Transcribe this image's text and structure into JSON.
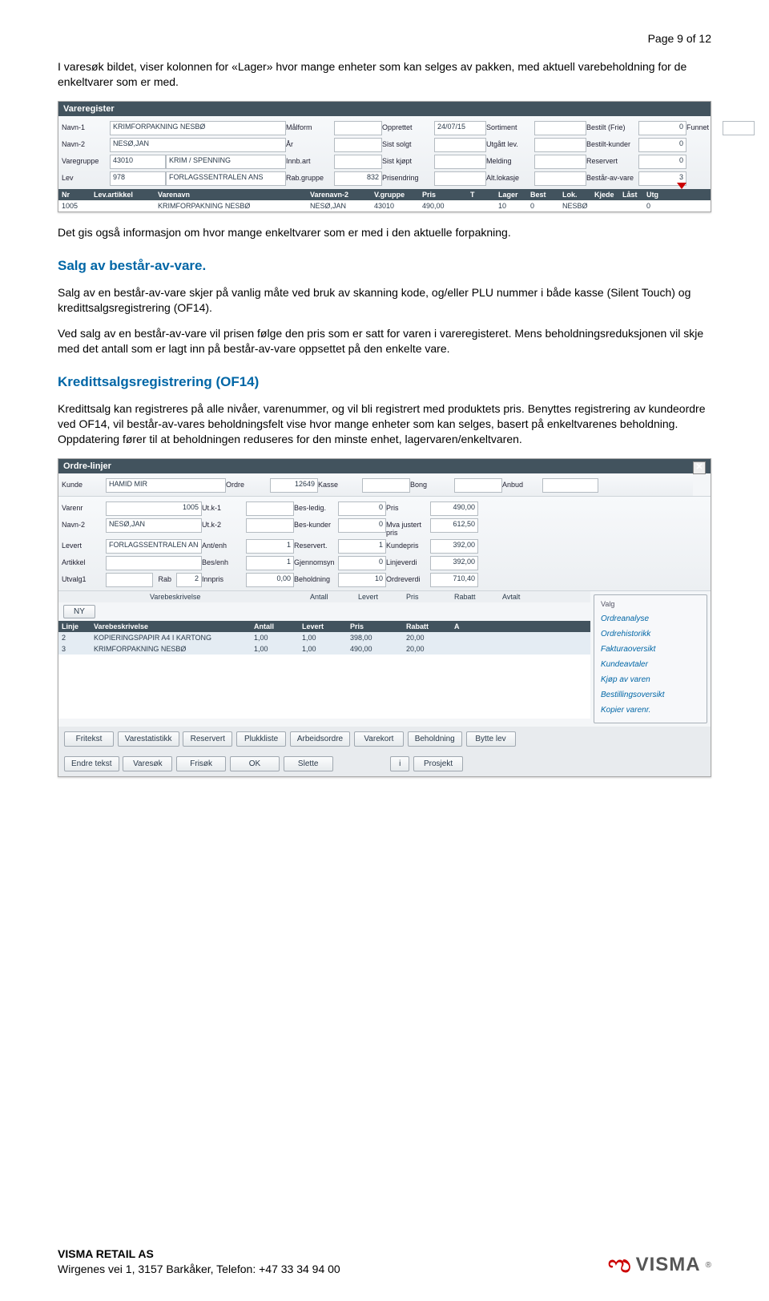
{
  "page_header": "Page 9 of 12",
  "intro_p": "I varesøk bildet, viser kolonnen for «Lager» hvor mange enheter som kan selges av pakken, med aktuell varebeholdning for de enkeltvarer som er med.",
  "s1": {
    "title": "Vareregister",
    "labels": {
      "navn1": "Navn-1",
      "navn2": "Navn-2",
      "varegruppe": "Varegruppe",
      "lev": "Lev",
      "malform": "Målform",
      "ar": "År",
      "innbart": "Innb.art",
      "rabgruppe": "Rab.gruppe",
      "opprettet": "Opprettet",
      "sistsolgt": "Sist solgt",
      "sistkjopt": "Sist kjøpt",
      "prisendring": "Prisendring",
      "sortiment": "Sortiment",
      "utgatt": "Utgått lev.",
      "melding": "Melding",
      "altlok": "Alt.lokasje",
      "bestiltfrie": "Bestilt (Frie)",
      "bestiltkunder": "Bestilt-kunder",
      "reservert": "Reservert",
      "bestaravvare": "Består-av-vare",
      "funnet": "Funnet"
    },
    "vals": {
      "navn1": "KRIMFORPAKNING NESBØ",
      "navn2": "NESØ,JAN",
      "vg_code": "43010",
      "vg_name": "KRIM / SPENNING",
      "lev_code": "978",
      "lev_name": "FORLAGSSENTRALEN ANS",
      "rabgruppe": "832",
      "opprettet": "24/07/15",
      "bestiltfrie": "0",
      "bestiltkunder": "0",
      "reservert": "0",
      "bestaravvare": "3"
    },
    "hdr": [
      "Nr",
      "Lev.artikkel",
      "Varenavn",
      "Varenavn-2",
      "V.gruppe",
      "Pris",
      "T",
      "Lager",
      "Best",
      "Lok.",
      "Kjede",
      "Låst",
      "Utg"
    ],
    "row": [
      "1005",
      "",
      "KRIMFORPAKNING NESBØ",
      "NESØ,JAN",
      "43010",
      "490,00",
      "",
      "10",
      "0",
      "NESBØ",
      "",
      "",
      "0"
    ]
  },
  "after_s1": "Det gis også informasjon om hvor mange enkeltvarer som er med i den aktuelle forpakning.",
  "sec1_title": "Salg av består-av-vare.",
  "sec1_p1": "Salg av en består-av-vare skjer på vanlig måte ved bruk av skanning kode, og/eller PLU nummer i både kasse (Silent Touch) og kredittsalgsregistrering (OF14).",
  "sec1_p2": "Ved salg av en består-av-vare vil prisen følge den pris som er satt for varen i vareregisteret. Mens beholdningsreduksjonen vil skje med det antall som er lagt inn på består-av-vare oppsettet på den enkelte vare.",
  "sec2_title": "Kredittsalgsregistrering (OF14)",
  "sec2_p": "Kredittsalg kan registreres på alle nivåer, varenummer, og vil bli registrert med produktets pris. Benyttes registrering av kundeordre ved OF14, vil består-av-vares beholdningsfelt vise hvor mange enheter som kan selges, basert på enkeltvarenes beholdning. Oppdatering fører til at beholdningen reduseres for den minste enhet, lagervaren/enkeltvaren.",
  "s2": {
    "title": "Ordre-linjer",
    "top": {
      "kunde_l": "Kunde",
      "kunde": "HAMID MIR",
      "ordre_l": "Ordre",
      "ordre": "12649",
      "kasse_l": "Kasse",
      "bong_l": "Bong",
      "anbud_l": "Anbud"
    },
    "left": {
      "varenr_l": "Varenr",
      "varenr": "1005",
      "navn2_l": "Navn-2",
      "navn2": "NESØ,JAN",
      "levert_l": "Levert",
      "levert": "FORLAGSSENTRALEN AN",
      "artikkel_l": "Artikkel",
      "utvalg1_l": "Utvalg1",
      "utvalg1_rab_l": "Rab",
      "utvalg1_rab": "2"
    },
    "mid": {
      "utk1_l": "Ut.k-1",
      "utk2_l": "Ut.k-2",
      "antenh_l": "Ant/enh",
      "antenh": "1",
      "besenh_l": "Bes/enh",
      "besenh": "1",
      "innpris_l": "Innpris",
      "innpris": "0,00"
    },
    "mid2": {
      "besledig_l": "Bes-ledig.",
      "besledig": "0",
      "beskunder_l": "Bes-kunder",
      "beskunder": "0",
      "reservert_l": "Reservert.",
      "reservert": "1",
      "gjennomsyn_l": "Gjennomsyn",
      "gjennomsyn": "0",
      "beholdning_l": "Beholdning",
      "beholdning": "10"
    },
    "right": {
      "pris_l": "Pris",
      "pris": "490,00",
      "mva_l": "Mva justert pris",
      "mva": "612,50",
      "kundepris_l": "Kundepris",
      "kundepris": "392,00",
      "linjeverdi_l": "Linjeverdi",
      "linjeverdi": "392,00",
      "ordreverdi_l": "Ordreverdi",
      "ordreverdi": "710,40"
    },
    "th": [
      "Varebeskrivelse",
      "Antall",
      "Levert",
      "Pris",
      "Rabatt",
      "Avtalt"
    ],
    "ny": "NY",
    "hdr": [
      "Linje",
      "Varebeskrivelse",
      "Antall",
      "Levert",
      "Pris",
      "Rabatt",
      "A"
    ],
    "rows": [
      [
        "2",
        "KOPIERINGSPAPIR A4 I KARTONG",
        "1,00",
        "1,00",
        "398,00",
        "20,00",
        ""
      ],
      [
        "3",
        "KRIMFORPAKNING NESBØ",
        "1,00",
        "1,00",
        "490,00",
        "20,00",
        ""
      ]
    ],
    "valg_title": "Valg",
    "valg": [
      "Ordreanalyse",
      "Ordrehistorikk",
      "Fakturaoversikt",
      "Kundeavtaler",
      "Kjøp av varen",
      "Bestillingsoversikt",
      "Kopier varenr."
    ],
    "btns1": [
      "Fritekst",
      "Varestatistikk",
      "Reservert",
      "Plukkliste",
      "Arbeidsordre",
      "Varekort",
      "Beholdning",
      "Bytte lev"
    ],
    "btns2": [
      "Endre tekst",
      "Varesøk",
      "Frisøk",
      "OK",
      "Slette",
      "",
      "i",
      "Prosjekt"
    ]
  },
  "footer": {
    "company": "VISMA RETAIL AS",
    "addr": "Wirgenes vei 1, 3157 Barkåker, Telefon: +47 33 34 94 00",
    "logo": "VISMA"
  }
}
